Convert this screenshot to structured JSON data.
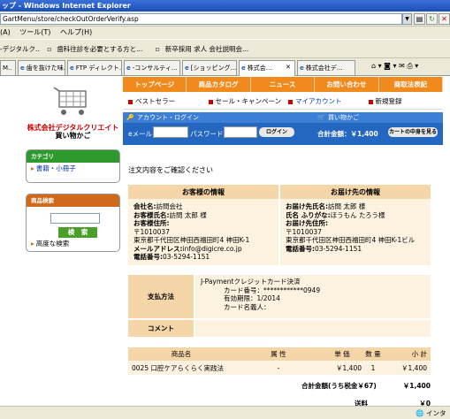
{
  "window": {
    "title": "ップ - Windows Internet Explorer"
  },
  "address": {
    "url": "GartMenu/store/checkOutOrderVerify.asp"
  },
  "menu": [
    "(A)",
    "ツール(T)",
    "ヘルプ(H)"
  ],
  "favorites": [
    "-デジタルク..",
    "歯科往診を必要とする方と...",
    "新卒採用 求人 会社説明会..."
  ],
  "tabs": [
    "M..",
    "歯を抜けた味...",
    "FTP ディレクト...",
    "-コンサルティ...",
    "[ショッピング...",
    "株式会...",
    "株式会社デ..."
  ],
  "sidebar": {
    "shop_name": "株式会社デジタルクリエイト",
    "shop_sub": "買い物かご",
    "category_head": "カテゴリ",
    "category_link": "書籍・小冊子",
    "search_head": "商品検索",
    "search_button": "検　索",
    "advanced_link": "高度な検索"
  },
  "nav": {
    "top": [
      "トップページ",
      "商品カタログ",
      "ニュース",
      "お問い合わせ",
      "商取法表記"
    ],
    "sub": [
      "ベストセラー",
      "セール・キャンペーン",
      "マイアカウント",
      "新規登録"
    ]
  },
  "login": {
    "header": "アカウント・ログイン",
    "cart_header": "買い物かご",
    "email_label": "eメール",
    "password_label": "パスワード",
    "login_button": "ログイン",
    "total_label": "合計金額：￥1,400",
    "view_cart_button": "カートの中身を見る"
  },
  "confirm_title": "注文内容をご確認ください",
  "customer": {
    "head": "お客様の情報",
    "lines": [
      [
        "会社名:",
        "訪問会社"
      ],
      [
        "お客様氏名:",
        "訪問 太郎 様"
      ],
      [
        "お客様住所:",
        ""
      ],
      [
        "",
        "〒1010037"
      ],
      [
        "",
        "東京都千代田区神田西福田町4 神田K-1"
      ],
      [
        "メールアドレス:",
        "info@digicre.co.jp"
      ],
      [
        "電話番号:",
        "03-5294-1151"
      ]
    ]
  },
  "delivery": {
    "head": "お届け先の情報",
    "lines": [
      [
        "お届け先氏名:",
        "訪問 太郎 様"
      ],
      [
        "氏名 ふりがな:",
        "ほうもん たろう様"
      ],
      [
        "お届け先住所:",
        ""
      ],
      [
        "",
        "〒1010037"
      ],
      [
        "",
        "東京都千代田区神田西福田町4 神田K-1ビル"
      ],
      [
        "電話番号:",
        "03-5294-1151"
      ]
    ]
  },
  "payment": {
    "label": "支払方法",
    "lines": [
      "J-Paymentクレジットカード決済",
      "カード番号：************0949",
      "有効期限：1/2014",
      "カード名義人：　　　　　"
    ],
    "comment_label": "コメント"
  },
  "items": {
    "headers": [
      "商品名",
      "属 性",
      "単 価",
      "数 量",
      "小 計"
    ],
    "rows": [
      [
        "0025 口腔ケアらくらく実践法",
        "-",
        "￥1,400",
        "1",
        "￥1,400"
      ]
    ]
  },
  "totals": {
    "total_label": "合計金額(うち税金￥67)",
    "total_amount": "￥1,400",
    "shipping_label": "送料",
    "shipping_amount": "￥0"
  },
  "status": {
    "zone": "インタ"
  }
}
